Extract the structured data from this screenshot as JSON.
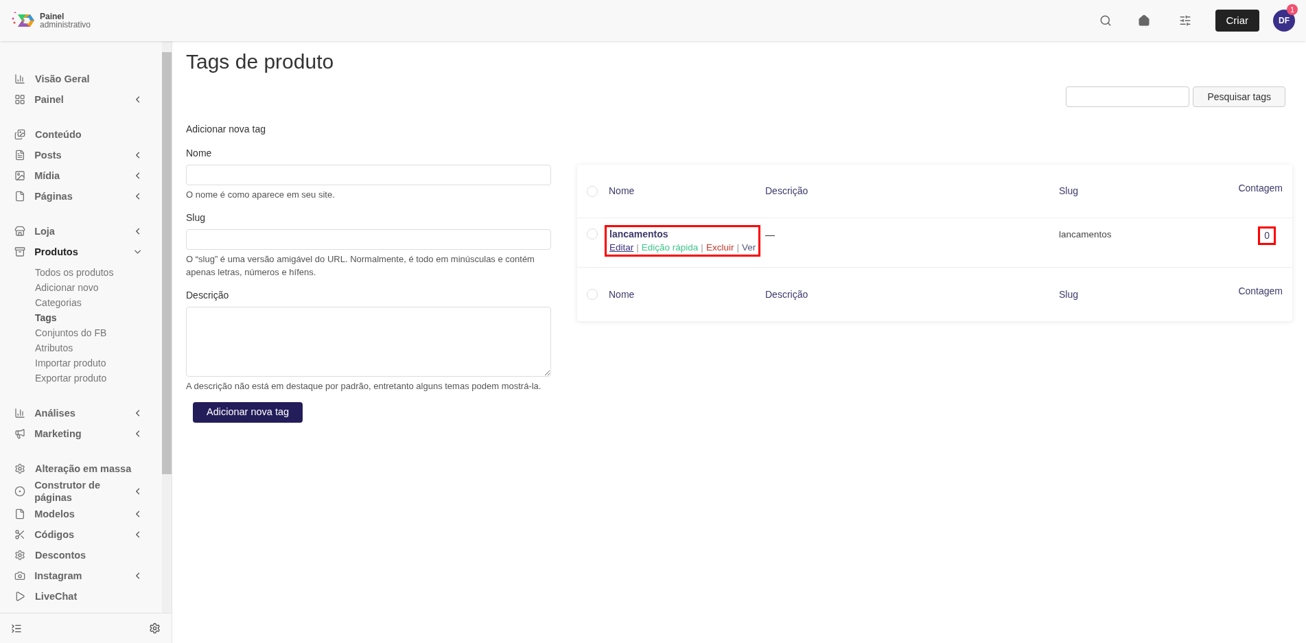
{
  "header": {
    "logo": {
      "line1": "Painel",
      "line2": "administrativo"
    },
    "create_button": "Criar",
    "avatar": {
      "initials": "DF",
      "badge": "1"
    }
  },
  "sidebar": {
    "groups": [
      {
        "items": [
          {
            "label": "Visão Geral",
            "has_submenu": false
          },
          {
            "label": "Painel",
            "has_submenu": true,
            "expanded": false
          }
        ]
      },
      {
        "items": [
          {
            "label": "Conteúdo",
            "has_submenu": false
          },
          {
            "label": "Posts",
            "has_submenu": true,
            "expanded": false
          },
          {
            "label": "Mídia",
            "has_submenu": true,
            "expanded": false
          },
          {
            "label": "Páginas",
            "has_submenu": true,
            "expanded": false
          }
        ]
      },
      {
        "items": [
          {
            "label": "Loja",
            "has_submenu": true,
            "expanded": false
          },
          {
            "label": "Produtos",
            "has_submenu": true,
            "expanded": true,
            "children": [
              {
                "label": "Todos os produtos",
                "selected": false
              },
              {
                "label": "Adicionar novo",
                "selected": false
              },
              {
                "label": "Categorias",
                "selected": false
              },
              {
                "label": "Tags",
                "selected": true
              },
              {
                "label": "Conjuntos do FB",
                "selected": false
              },
              {
                "label": "Atributos",
                "selected": false
              },
              {
                "label": "Importar produto",
                "selected": false
              },
              {
                "label": "Exportar produto",
                "selected": false
              }
            ]
          }
        ]
      },
      {
        "items": [
          {
            "label": "Análises",
            "has_submenu": true,
            "expanded": false
          },
          {
            "label": "Marketing",
            "has_submenu": true,
            "expanded": false
          }
        ]
      },
      {
        "items": [
          {
            "label": "Alteração em massa",
            "has_submenu": false
          },
          {
            "label": "Construtor de páginas",
            "has_submenu": true,
            "expanded": false
          },
          {
            "label": "Modelos",
            "has_submenu": true,
            "expanded": false
          },
          {
            "label": "Códigos",
            "has_submenu": true,
            "expanded": false
          },
          {
            "label": "Descontos",
            "has_submenu": false
          },
          {
            "label": "Instagram",
            "has_submenu": true,
            "expanded": false
          },
          {
            "label": "LiveChat",
            "has_submenu": false
          }
        ]
      }
    ]
  },
  "page": {
    "title": "Tags de produto",
    "search": {
      "button": "Pesquisar tags"
    },
    "form": {
      "heading": "Adicionar nova tag",
      "fields": [
        {
          "label": "Nome",
          "kind": "input",
          "hint": "O nome é como aparece em seu site."
        },
        {
          "label": "Slug",
          "kind": "input",
          "hint": "O “slug” é uma versão amigável do URL. Normalmente, é todo em minúsculas e contém apenas letras, números e hífens."
        },
        {
          "label": "Descrição",
          "kind": "textarea",
          "hint": "A descrição não está em destaque por padrão, entretanto alguns temas podem mostrá-la."
        }
      ],
      "submit": "Adicionar nova tag"
    },
    "table": {
      "columns": [
        "Nome",
        "Descrição",
        "Slug",
        "Contagem"
      ],
      "select_all_checked": false,
      "footer_select_all_checked": false,
      "rows": [
        {
          "checked": false,
          "action_separator": "|",
          "name": "lancamentos",
          "description": "—",
          "slug": "lancamentos",
          "count": "0",
          "name_highlighted": true,
          "count_highlighted": true,
          "actions": [
            {
              "label": "Editar",
              "kind": "edit"
            },
            {
              "label": "Edição rápida",
              "kind": "quick_edit"
            },
            {
              "label": "Excluir",
              "kind": "delete"
            },
            {
              "label": "Ver",
              "kind": "view"
            }
          ]
        }
      ],
      "footer_columns": [
        "Nome",
        "Descrição",
        "Slug",
        "Contagem"
      ]
    }
  }
}
